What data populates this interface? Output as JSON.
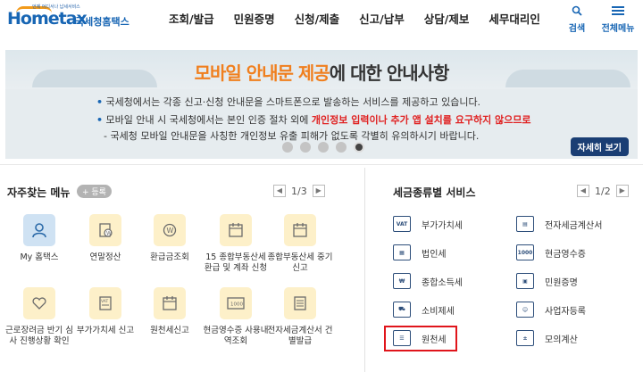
{
  "header": {
    "logo_tagline": "언제 어디서나 납세서비스",
    "logo_brand": "Hometax",
    "logo_brand_kr": "국세청홈택스",
    "menus": [
      "조회/발급",
      "민원증명",
      "신청/제출",
      "신고/납부",
      "상담/제보",
      "세무대리인"
    ],
    "search_label": "검색",
    "allmenu_label": "전체메뉴"
  },
  "banner": {
    "title_highlight": "모바일 안내문 제공",
    "title_rest": "에 대한 안내사항",
    "line1": "국세청에서는 각종 신고·신청 안내문을 스마트폰으로 발송하는 서비스를 제공하고 있습니다.",
    "line2_prefix": "모바일 안내 시 국세청에서는 본인 인증 절차 외에 ",
    "line2_red": "개인정보 입력이나 추가 앱 설치를 요구하지 않으므로",
    "line3": "- 국세청 모바일 안내문을 사칭한 개인정보 유출 피해가 없도록 각별히 유의하시기 바랍니다.",
    "detail_button": "자세히 보기",
    "active_dot": 5,
    "dot_count": 5
  },
  "favorites": {
    "title": "자주찾는 메뉴",
    "register_button": "+ 등록",
    "pager": "1/3",
    "items": [
      {
        "label": "My 홈택스",
        "icon": "user-icon"
      },
      {
        "label": "연말정산",
        "icon": "document-won-icon"
      },
      {
        "label": "환급금조회",
        "icon": "refund-icon"
      },
      {
        "label": "15 종합부동산세 환급 및 계좌 신청",
        "icon": "calendar-icon"
      },
      {
        "label": "종합부동산세 중기신고",
        "icon": "calendar-icon"
      },
      {
        "label": "근로장려금 반기 심사 진행상황 확인",
        "icon": "heart-search-icon"
      },
      {
        "label": "부가가치세 신고",
        "icon": "vat-document-icon"
      },
      {
        "label": "원천세신고",
        "icon": "calendar-icon"
      },
      {
        "label": "현금영수증 사용내역조회",
        "icon": "receipt-icon"
      },
      {
        "label": "전자세금계산서 건별발급",
        "icon": "invoice-icon"
      }
    ]
  },
  "tax_services": {
    "title": "세금종류별 서비스",
    "pager": "1/2",
    "left": [
      {
        "label": "부가가치세",
        "icon": "vat-icon",
        "glyph": "VAT"
      },
      {
        "label": "법인세",
        "icon": "building-icon",
        "glyph": "▦"
      },
      {
        "label": "종합소득세",
        "icon": "money-bag-icon",
        "glyph": "₩"
      },
      {
        "label": "소비제세",
        "icon": "cart-icon",
        "glyph": "⛟"
      },
      {
        "label": "원천세",
        "icon": "checklist-icon",
        "glyph": "☰"
      }
    ],
    "right": [
      {
        "label": "전자세금계산서",
        "icon": "invoice-icon",
        "glyph": "▤"
      },
      {
        "label": "현금영수증",
        "icon": "receipt-icon",
        "glyph": "1000"
      },
      {
        "label": "민원증명",
        "icon": "certificate-icon",
        "glyph": "▣"
      },
      {
        "label": "사업자등록",
        "icon": "person-icon",
        "glyph": "☺"
      },
      {
        "label": "모의계산",
        "icon": "calculator-icon",
        "glyph": "±"
      }
    ],
    "highlighted": "원천세"
  },
  "colors": {
    "brand_blue": "#1866b4",
    "accent_orange": "#f07f1e",
    "warning_red": "#e02121",
    "highlight_border": "#e0151b"
  }
}
